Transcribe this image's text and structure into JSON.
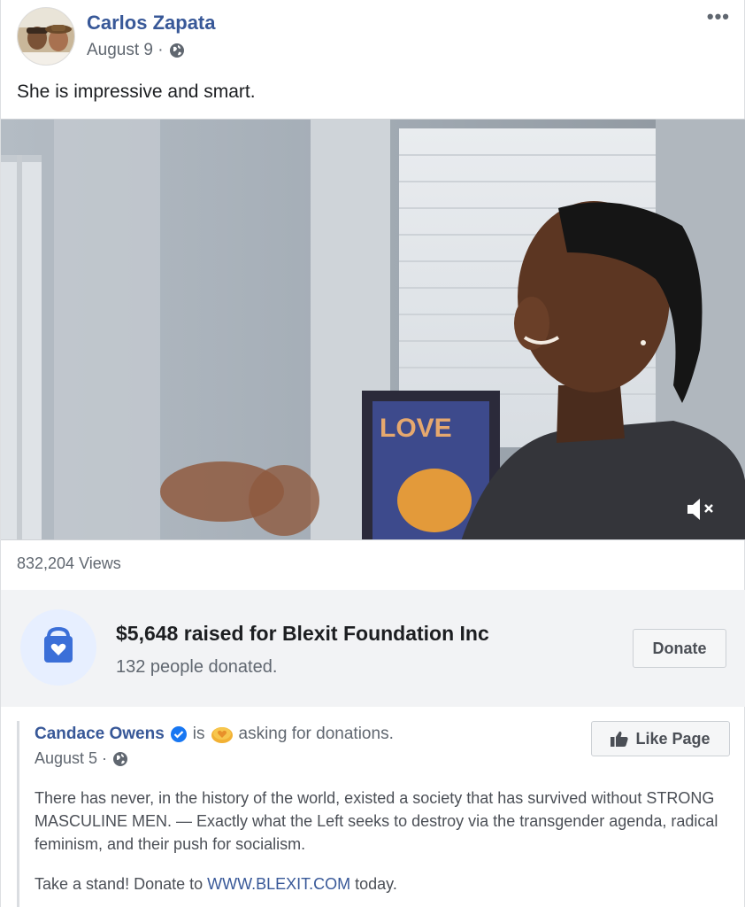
{
  "post": {
    "author": "Carlos Zapata",
    "date": "August 9 · ",
    "privacy_icon": "globe-icon",
    "more_label": "•••",
    "caption": "She is impressive and smart."
  },
  "video": {
    "views": "832,204 Views",
    "mute_icon": "volume-muted-icon",
    "poster_text": "LOVE"
  },
  "fundraiser": {
    "title": "$5,648 raised for Blexit Foundation Inc",
    "subtitle": "132 people donated.",
    "donate_label": "Donate",
    "icon": "donation-bag-icon"
  },
  "shared_post": {
    "author": "Candace Owens",
    "verified_icon": "verified-badge-icon",
    "is_text": "is",
    "activity_icon": "heart-coin-icon",
    "activity": "asking for donations.",
    "date": "August 5 · ",
    "like_page_label": "Like Page",
    "body": "There has never, in the history of the world, existed a society that has survived without STRONG MASCULINE MEN. — Exactly what the Left seeks to destroy via the transgender agenda, radical feminism, and their push for socialism.",
    "cta_prefix": "Take a stand! Donate to ",
    "cta_link": "WWW.BLEXIT.COM",
    "cta_suffix": " today."
  },
  "colors": {
    "link_blue": "#385898",
    "muted_text": "#606770",
    "fund_bg": "#f2f3f5",
    "verified_blue": "#1877f2",
    "donate_icon_blue": "#3b6fd8"
  }
}
